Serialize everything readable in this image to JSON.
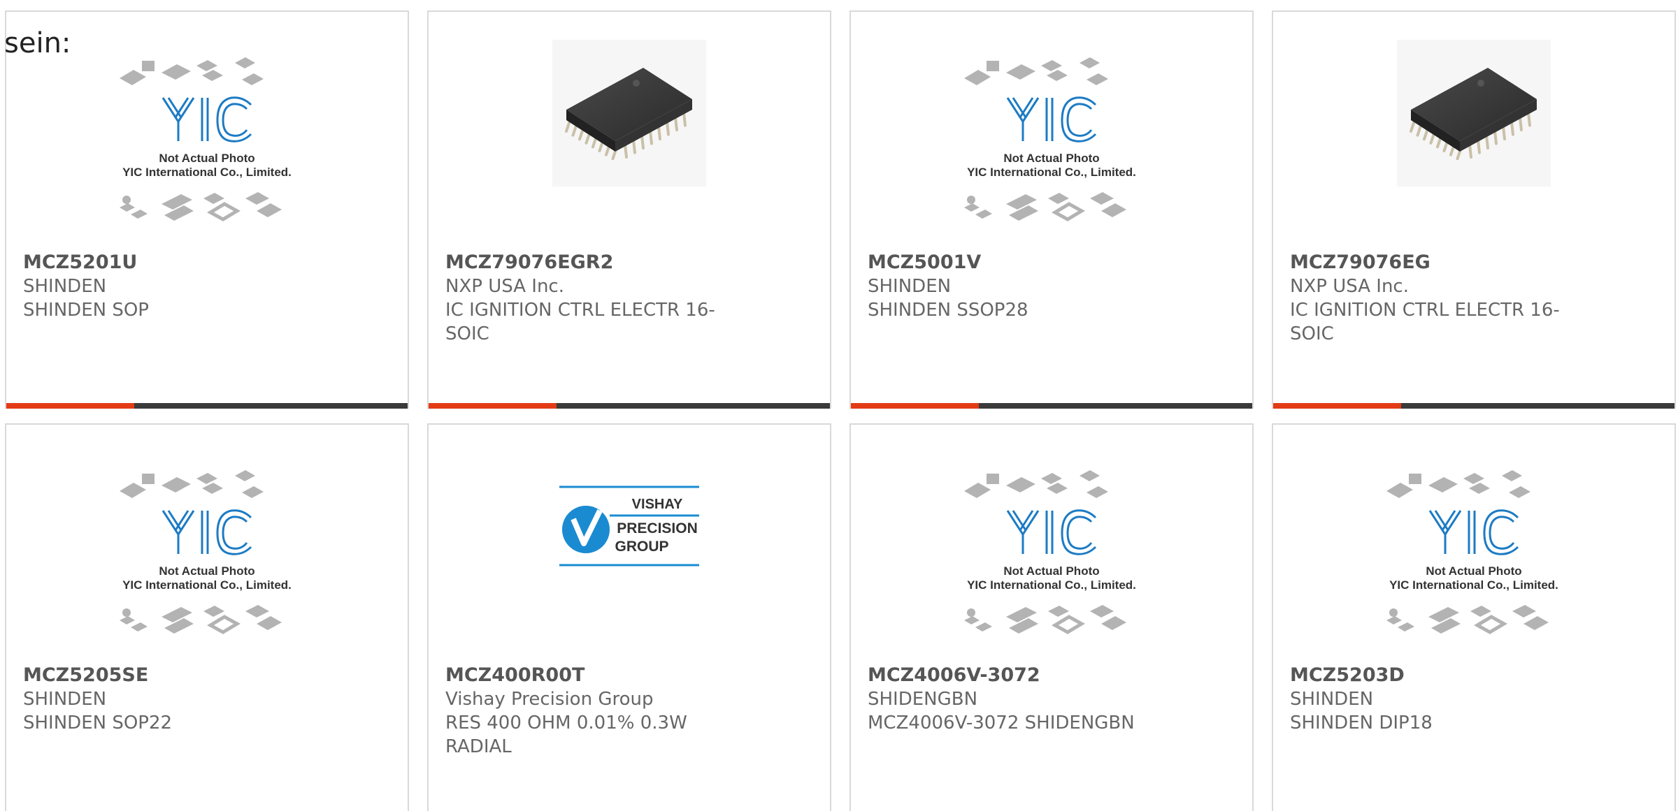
{
  "intro_text": "sein:",
  "placeholder_image": {
    "logo_text": "YIC",
    "line1": "Not Actual Photo",
    "line2": "YIC International Co., Limited."
  },
  "vishay_logo": {
    "line1": "VISHAY",
    "line2": "PRECISION",
    "line3": "GROUP"
  },
  "colors": {
    "accent": "#e23b16",
    "bar": "#3a3a3a",
    "yic_blue": "#1c7bc4",
    "vishay_blue": "#1a8bd1"
  },
  "products": [
    {
      "part_number": "MCZ5201U",
      "manufacturer": "SHINDEN",
      "description": "SHINDEN SOP",
      "image": "placeholder"
    },
    {
      "part_number": "MCZ79076EGR2",
      "manufacturer": "NXP USA Inc.",
      "description": "IC IGNITION CTRL ELECTR 16-SOIC",
      "image": "soic-chip"
    },
    {
      "part_number": "MCZ5001V",
      "manufacturer": "SHINDEN",
      "description": "SHINDEN SSOP28",
      "image": "placeholder"
    },
    {
      "part_number": "MCZ79076EG",
      "manufacturer": "NXP USA Inc.",
      "description": "IC IGNITION CTRL ELECTR 16-SOIC",
      "image": "soic-chip"
    },
    {
      "part_number": "MCZ5205SE",
      "manufacturer": "SHINDEN",
      "description": "SHINDEN SOP22",
      "image": "placeholder"
    },
    {
      "part_number": "MCZ400R00T",
      "manufacturer": "Vishay Precision Group",
      "description": "RES 400 OHM 0.01% 0.3W RADIAL",
      "image": "vishay-logo"
    },
    {
      "part_number": "MCZ4006V-3072",
      "manufacturer": "SHIDENGBN",
      "description": "MCZ4006V-3072 SHIDENGBN",
      "image": "placeholder"
    },
    {
      "part_number": "MCZ5203D",
      "manufacturer": "SHINDEN",
      "description": "SHINDEN DIP18",
      "image": "placeholder"
    }
  ]
}
